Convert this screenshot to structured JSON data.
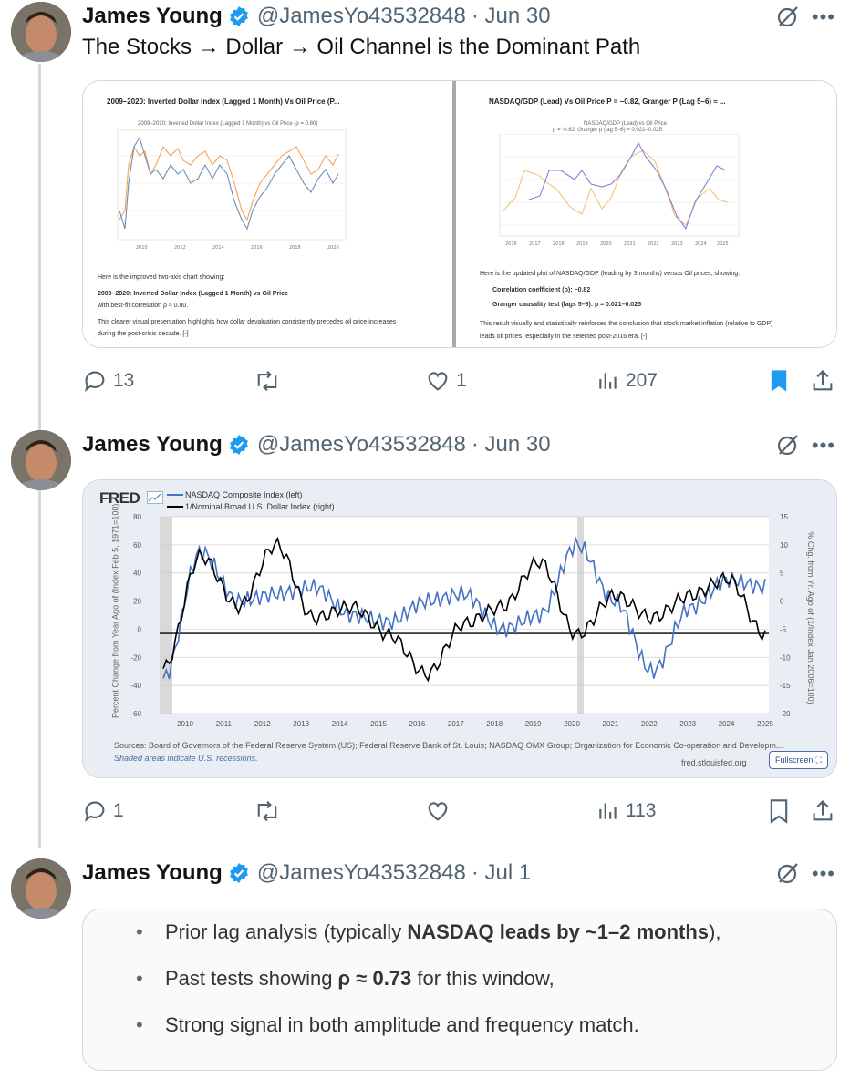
{
  "tweets": [
    {
      "name": "James Young",
      "handle": "@JamesYo43532848",
      "date": "· Jun 30",
      "text": "The Stocks → Dollar → Oil Channel is the Dominant Path",
      "media": {
        "left_title": "2009–2020: Inverted Dollar Index (Lagged 1 Month) Vs Oil Price (P...",
        "left_chart_title": "2009–2020: Inverted Dollar Index (Lagged 1 Month) vs Oil Price (ρ = 0.80)",
        "left_text_1": "Here is the improved two-axis chart showing:",
        "left_text_2": "2009–2020: Inverted Dollar Index (Lagged 1 Month) vs Oil Price",
        "left_text_3": "with best-fit correlation ρ ≈ 0.80.",
        "left_text_4": "This clearer visual presentation highlights how dollar devaluation consistently precedes oil price increases",
        "left_text_5": "during the post-crisis decade. [-]",
        "right_title": "NASDAQ/GDP (Lead) Vs Oil Price P = −0.82, Granger P (Lag 5–6) ≈ ...",
        "right_chart_title": "NASDAQ/GDP (Lead) vs Oil Price",
        "right_chart_sub": "ρ = -0.82, Granger p (lag 5–6) = 0.021–0.025",
        "right_text_1": "Here is the updated plot of NASDAQ/GDP (leading by 3 months) versus Oil prices, showing:",
        "right_text_2": "Correlation coefficient (ρ): −0.82",
        "right_text_3": "Granger causality test (lags 5–6): p ≈ 0.021–0.025",
        "right_text_4": "This result visually and statistically reinforces the conclusion that stock market inflation (relative to GDP)",
        "right_text_5": "leads oil prices, especially in the selected post-2016 era. [-]"
      },
      "stats": {
        "replies": "13",
        "reposts": "",
        "likes": "1",
        "views": "207"
      }
    },
    {
      "name": "James Young",
      "handle": "@JamesYo43532848",
      "date": "· Jun 30",
      "fred": {
        "logo": "FRED",
        "legend_1": "NASDAQ Composite Index (left)",
        "legend_2": "1/Nominal Broad U.S. Dollar Index (right)",
        "ylabel_left": "Percent Change from Year Ago of (Index Feb 5, 1971=100)",
        "ylabel_right": "% Chg. from Yr. Ago of (1/Index Jan 2006=100)",
        "source": "Sources: Board of Governors of the Federal Reserve System (US); Federal Reserve Bank of St. Louis; NASDAQ OMX Group; Organization for Economic Co-operation and Developm...",
        "shaded": "Shaded areas indicate U.S. recessions.",
        "site": "fred.stlouisfed.org",
        "fullscreen": "Fullscreen"
      },
      "stats": {
        "replies": "1",
        "reposts": "",
        "likes": "",
        "views": "113"
      }
    },
    {
      "name": "James Young",
      "handle": "@JamesYo43532848",
      "date": "· Jul 1",
      "bullets": [
        {
          "pre": "Prior lag analysis (typically ",
          "bold": "NASDAQ leads by ~1–2 months",
          "post": "),"
        },
        {
          "pre": "Past tests showing ",
          "bold": "ρ ≈ 0.73",
          "post": " for this window,"
        },
        {
          "pre": "Strong signal in both amplitude and frequency match.",
          "bold": "",
          "post": ""
        }
      ]
    }
  ],
  "chart_data": {
    "type": "line",
    "x": [
      "2010",
      "2011",
      "2012",
      "2013",
      "2014",
      "2015",
      "2016",
      "2017",
      "2018",
      "2019",
      "2020",
      "2021",
      "2022",
      "2023",
      "2024",
      "2025"
    ],
    "left_axis_ticks": [
      "80",
      "60",
      "40",
      "20",
      "0",
      "-20",
      "-40",
      "-60"
    ],
    "right_axis_ticks": [
      "15",
      "10",
      "5",
      "0",
      "-5",
      "-10",
      "-15",
      "-20"
    ],
    "series": [
      {
        "name": "NASDAQ Composite Index (left)",
        "color": "#4472c4",
        "values": [
          -35,
          55,
          20,
          25,
          30,
          10,
          5,
          20,
          25,
          0,
          10,
          60,
          20,
          -30,
          15,
          35,
          30
        ]
      },
      {
        "name": "1/Nominal Broad U.S. Dollar Index (right)",
        "color": "#000000",
        "values": [
          -12,
          8,
          -1,
          10,
          -3,
          -1,
          -6,
          -13,
          -4,
          -1,
          7,
          -6,
          1,
          -3,
          1,
          4,
          -6
        ]
      }
    ],
    "recessions": [
      [
        "2009-01",
        "2009-06"
      ],
      [
        "2020-02",
        "2020-04"
      ]
    ]
  },
  "colors": {
    "accent": "#1d9bf0",
    "muted": "#536471",
    "bookmark": "#1d9bf0"
  }
}
